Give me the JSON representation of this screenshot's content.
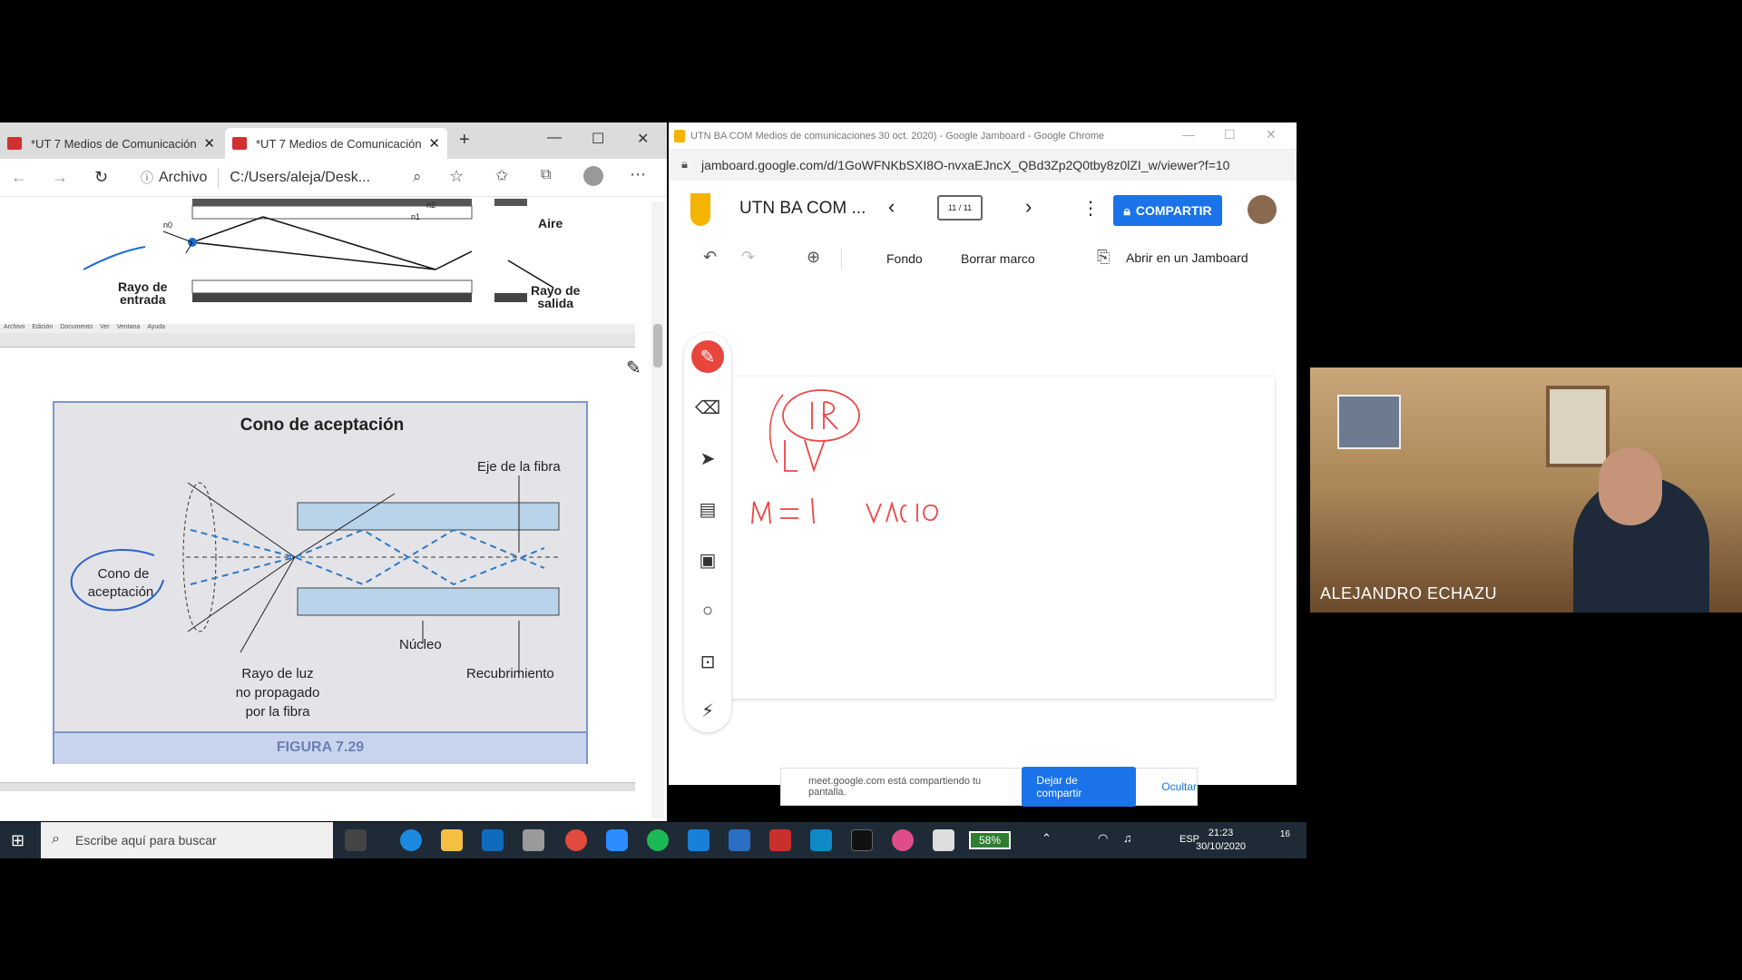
{
  "edge": {
    "tabs": [
      {
        "label": "*UT 7 Medios de Comunicación"
      },
      {
        "label": "*UT 7 Medios de Comunicación"
      }
    ],
    "new_tab": "+",
    "address": {
      "site_label": "Archivo",
      "path": "C:/Users/aleja/Desk..."
    },
    "pdf": {
      "fig_top": {
        "label_aire": "Aire",
        "label_in": "Rayo de\nentrada",
        "label_out": "Rayo de\nsalida",
        "n2": "n2",
        "n1": "n1",
        "n0": "n0"
      },
      "menu": [
        "Archivo",
        "Edición",
        "Documento",
        "Ver",
        "Ventana",
        "Ayuda"
      ],
      "figure": {
        "title": "Cono de aceptación",
        "eje": "Eje de la fibra",
        "cono_1": "Cono de",
        "cono_2": "aceptación",
        "nucleo": "Núcleo",
        "rayo_1": "Rayo de luz",
        "rayo_2": "no propagado",
        "rayo_3": "por la fibra",
        "recubrimiento": "Recubrimiento",
        "caption": "FIGURA 7.29"
      }
    }
  },
  "chrome": {
    "title": "UTN BA COM Medios de comunicaciones 30 oct. 2020) - Google Jamboard - Google Chrome",
    "url": "jamboard.google.com/d/1GoWFNKbSXI8O-nvxaEJncX_QBd3Zp2Q0tby8z0lZI_w/viewer?f=10",
    "jam_title": "UTN BA COM ...",
    "frame_counter": "11 / 11",
    "share_label": "COMPARTIR",
    "fondo": "Fondo",
    "borrar": "Borrar marco",
    "abrir": "Abrir en un Jamboard"
  },
  "sharebar": {
    "text": "meet.google.com está compartiendo tu pantalla.",
    "stop": "Dejar de compartir",
    "hide": "Ocultar"
  },
  "video": {
    "participant": "ALEJANDRO ECHAZU"
  },
  "taskbar": {
    "search_placeholder": "Escribe aquí para buscar",
    "battery": "58%",
    "lang": "ESP",
    "time": "21:23",
    "date": "30/10/2020",
    "notif_count": "16"
  }
}
